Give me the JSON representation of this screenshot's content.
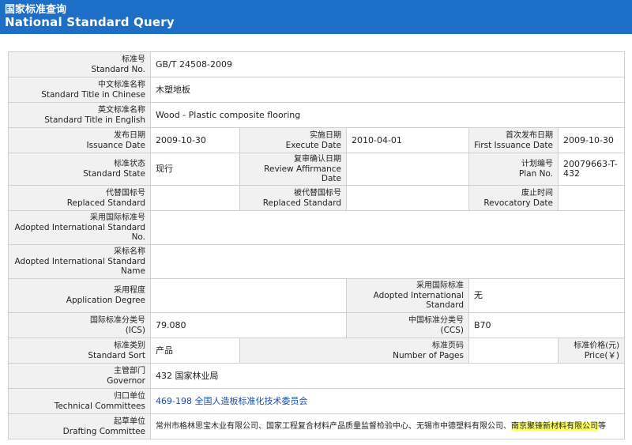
{
  "header": {
    "title_cn": "国家标准查询",
    "title_en": "National Standard Query"
  },
  "labels": {
    "standard_no": {
      "cn": "标准号",
      "en": "Standard No."
    },
    "title_cn": {
      "cn": "中文标准名称",
      "en": "Standard Title in Chinese"
    },
    "title_en": {
      "cn": "英文标准名称",
      "en": "Standard Title in English"
    },
    "issuance_date": {
      "cn": "发布日期",
      "en": "Issuance Date"
    },
    "execute_date": {
      "cn": "实施日期",
      "en": "Execute Date"
    },
    "first_issuance_date": {
      "cn": "首次发布日期",
      "en": "First Issuance Date"
    },
    "standard_state": {
      "cn": "标准状态",
      "en": "Standard State"
    },
    "review_affirmance_date": {
      "cn": "复审确认日期",
      "en": "Review Affirmance Date"
    },
    "plan_no": {
      "cn": "计划编号",
      "en": "Plan No."
    },
    "replaced_standard": {
      "cn": "代替国标号",
      "en": "Replaced Standard"
    },
    "replaced_by": {
      "cn": "被代替国标号",
      "en": "Replaced Standard"
    },
    "revocatory_date": {
      "cn": "废止时间",
      "en": "Revocatory Date"
    },
    "adopted_intl_no": {
      "cn": "采用国际标准号",
      "en": "Adopted International Standard No."
    },
    "adopted_intl_name": {
      "cn": "采标名称",
      "en": "Adopted International Standard Name"
    },
    "application_degree": {
      "cn": "采用程度",
      "en": "Application Degree"
    },
    "adopted_intl_standard": {
      "cn": "采用国际标准",
      "en": "Adopted International Standard"
    },
    "ics": {
      "cn": "国际标准分类号",
      "en": "(ICS)"
    },
    "ccs": {
      "cn": "中国标准分类号",
      "en": "(CCS)"
    },
    "standard_sort": {
      "cn": "标准类别",
      "en": "Standard Sort"
    },
    "number_of_pages": {
      "cn": "标准页码",
      "en": "Number of Pages"
    },
    "price": {
      "cn": "标准价格(元)",
      "en": "Price(￥)"
    },
    "governor": {
      "cn": "主管部门",
      "en": "Governor"
    },
    "technical_committees": {
      "cn": "归口单位",
      "en": "Technical Committees"
    },
    "drafting_committee": {
      "cn": "起草单位",
      "en": "Drafting Committee"
    }
  },
  "values": {
    "standard_no": "GB/T 24508-2009",
    "title_cn": "木塑地板",
    "title_en": "Wood - Plastic composite flooring",
    "issuance_date": "2009-10-30",
    "execute_date": "2010-04-01",
    "first_issuance_date": "2009-10-30",
    "standard_state": "现行",
    "review_affirmance_date": "",
    "plan_no": "20079663-T-432",
    "replaced_standard": "",
    "replaced_by": "",
    "revocatory_date": "",
    "adopted_intl_no": "",
    "adopted_intl_name": "",
    "application_degree": "",
    "adopted_intl_standard": "无",
    "ics": "79.080",
    "ccs": "B70",
    "standard_sort": "产品",
    "number_of_pages": "",
    "price": "",
    "governor": "432 国家林业局",
    "technical_committees": "469-198 全国人造板标准化技术委员会",
    "drafting_committee_plain": "常州市格林思宝木业有限公司、国家工程复合材料产品质量监督检验中心、无锡市中德塑料有限公司、",
    "drafting_committee_highlight": "南京聚锋新材料有限公司",
    "drafting_committee_suffix": "等"
  }
}
